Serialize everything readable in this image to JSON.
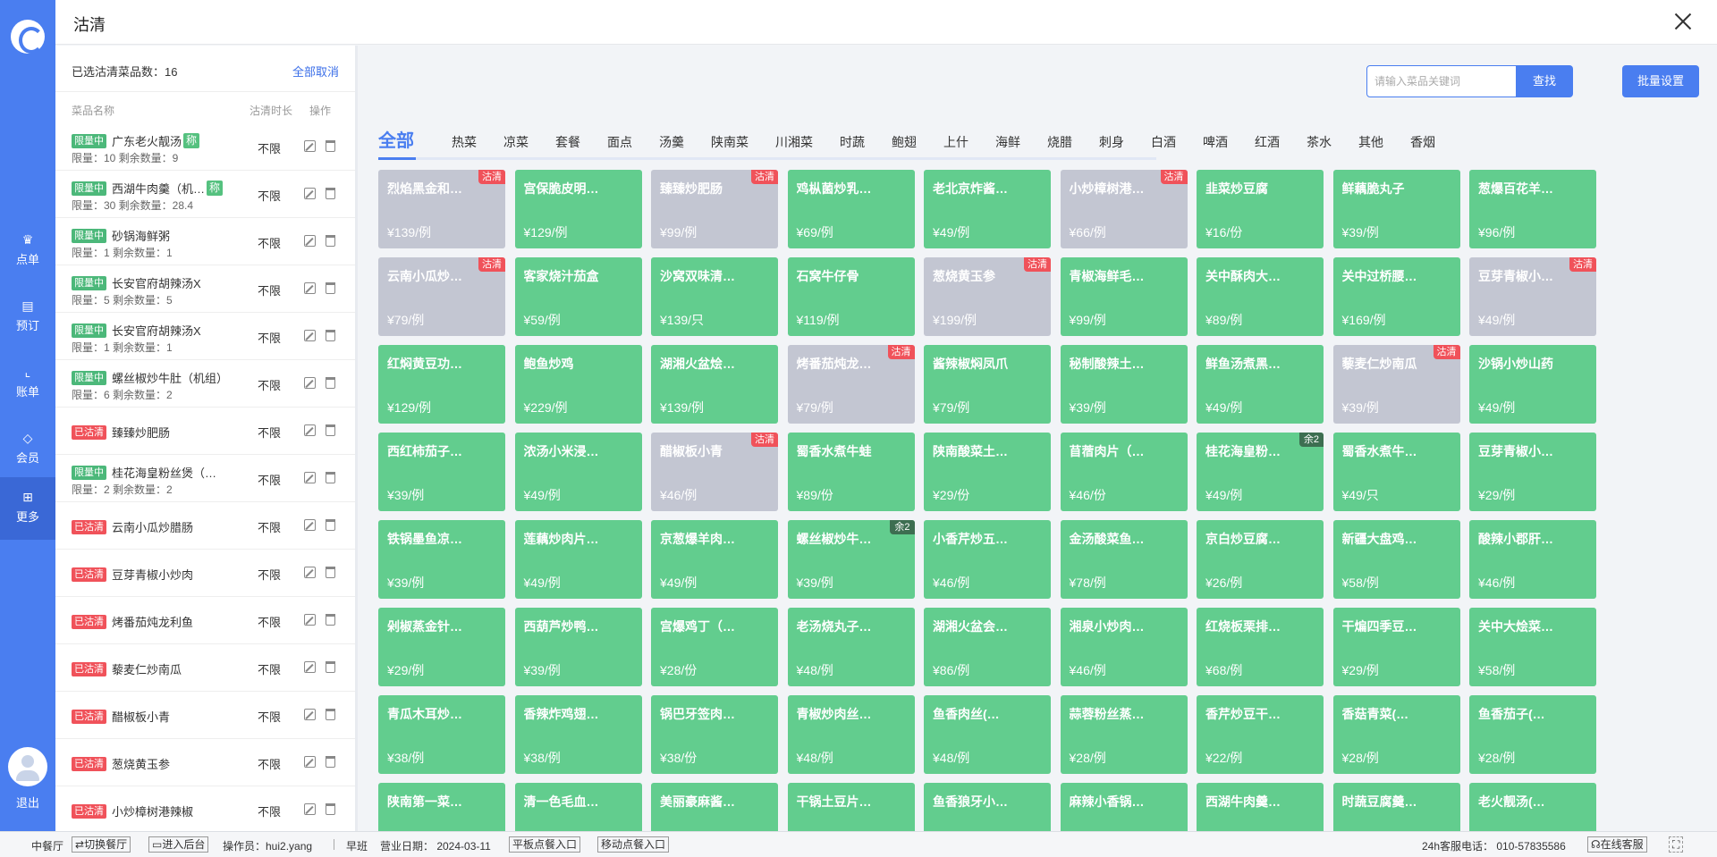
{
  "title": "沽清",
  "nav": [
    {
      "label": "点单",
      "icon": "chef-hat-icon"
    },
    {
      "label": "预订",
      "icon": "book-icon"
    },
    {
      "label": "账单",
      "icon": "chart-icon"
    },
    {
      "label": "会员",
      "icon": "diamond-icon"
    },
    {
      "label": "更多",
      "icon": "grid-icon"
    }
  ],
  "logout": "退出",
  "left": {
    "count_label": "已选沽清菜品数：16",
    "cancel_all": "全部取消",
    "col_name": "菜品名称",
    "col_duration": "沽清时长",
    "col_op": "操作",
    "rows": [
      {
        "tag": "限量中",
        "tagType": "limit",
        "name": "广东老火靓汤",
        "cheng": "称",
        "line2": "限量：10  剩余数量：9",
        "dur": "不限"
      },
      {
        "tag": "限量中",
        "tagType": "limit",
        "name": "西湖牛肉羹（机…",
        "cheng": "称",
        "line2": "限量：30  剩余数量：28.4",
        "dur": "不限"
      },
      {
        "tag": "限量中",
        "tagType": "limit",
        "name": "砂锅海鲜粥",
        "cheng": "",
        "line2": "限量：1  剩余数量：1",
        "dur": "不限"
      },
      {
        "tag": "限量中",
        "tagType": "limit",
        "name": "长安官府胡辣汤X",
        "cheng": "",
        "line2": "限量：5  剩余数量：5",
        "dur": "不限"
      },
      {
        "tag": "限量中",
        "tagType": "limit",
        "name": "长安官府胡辣汤X",
        "cheng": "",
        "line2": "限量：1  剩余数量：1",
        "dur": "不限"
      },
      {
        "tag": "限量中",
        "tagType": "limit",
        "name": "螺丝椒炒牛肚（机组）",
        "cheng": "",
        "line2": "限量：6  剩余数量：2",
        "dur": "不限"
      },
      {
        "tag": "已沽清",
        "tagType": "sold",
        "name": "臻臻炒肥肠",
        "cheng": "",
        "line2": "",
        "dur": "不限"
      },
      {
        "tag": "限量中",
        "tagType": "limit",
        "name": "桂花海皇粉丝煲（…",
        "cheng": "",
        "line2": "限量：2  剩余数量：2",
        "dur": "不限"
      },
      {
        "tag": "已沽清",
        "tagType": "sold",
        "name": "云南小瓜炒腊肠",
        "cheng": "",
        "line2": "",
        "dur": "不限"
      },
      {
        "tag": "已沽清",
        "tagType": "sold",
        "name": "豆芽青椒小炒肉",
        "cheng": "",
        "line2": "",
        "dur": "不限"
      },
      {
        "tag": "已沽清",
        "tagType": "sold",
        "name": "烤番茄炖龙利鱼",
        "cheng": "",
        "line2": "",
        "dur": "不限"
      },
      {
        "tag": "已沽清",
        "tagType": "sold",
        "name": "藜麦仁炒南瓜",
        "cheng": "",
        "line2": "",
        "dur": "不限"
      },
      {
        "tag": "已沽清",
        "tagType": "sold",
        "name": "醋椒板小青",
        "cheng": "",
        "line2": "",
        "dur": "不限"
      },
      {
        "tag": "已沽清",
        "tagType": "sold",
        "name": "葱烧黄玉参",
        "cheng": "",
        "line2": "",
        "dur": "不限"
      },
      {
        "tag": "已沽清",
        "tagType": "sold",
        "name": "小炒樟树港辣椒",
        "cheng": "",
        "line2": "",
        "dur": "不限"
      }
    ]
  },
  "search": {
    "placeholder": "请输入菜品关键词",
    "value": "",
    "find": "查找",
    "batch": "批量设置"
  },
  "tabs": [
    "全部",
    "热菜",
    "凉菜",
    "套餐",
    "面点",
    "汤羹",
    "陕南菜",
    "川湘菜",
    "时蔬",
    "鲍翅",
    "上什",
    "海鲜",
    "烧腊",
    "刺身",
    "白酒",
    "啤酒",
    "红酒",
    "茶水",
    "其他",
    "香烟"
  ],
  "sold_badge": "沽清",
  "dishes": [
    {
      "name": "烈焰黑金和…",
      "price": "¥139/例",
      "status": "sold"
    },
    {
      "name": "宫保脆皮明…",
      "price": "¥129/例",
      "status": ""
    },
    {
      "name": "臻臻炒肥肠",
      "price": "¥99/例",
      "status": "sold"
    },
    {
      "name": "鸡枞菌炒乳…",
      "price": "¥69/例",
      "status": ""
    },
    {
      "name": "老北京炸酱…",
      "price": "¥49/例",
      "status": ""
    },
    {
      "name": "小炒樟树港…",
      "price": "¥66/例",
      "status": "sold"
    },
    {
      "name": "韭菜炒豆腐",
      "price": "¥16/份",
      "status": ""
    },
    {
      "name": "鲜藕脆丸子",
      "price": "¥39/例",
      "status": ""
    },
    {
      "name": "葱爆百花羊…",
      "price": "¥96/例",
      "status": ""
    },
    {
      "name": "云南小瓜炒…",
      "price": "¥79/例",
      "status": "sold"
    },
    {
      "name": "客家烧汁茄盒",
      "price": "¥59/例",
      "status": ""
    },
    {
      "name": "沙窝双味清…",
      "price": "¥139/只",
      "status": ""
    },
    {
      "name": "石窝牛仔骨",
      "price": "¥119/例",
      "status": ""
    },
    {
      "name": "葱烧黄玉参",
      "price": "¥199/例",
      "status": "sold"
    },
    {
      "name": "青椒海鲜毛…",
      "price": "¥99/例",
      "status": ""
    },
    {
      "name": "关中酥肉大…",
      "price": "¥89/例",
      "status": ""
    },
    {
      "name": "关中过桥腰…",
      "price": "¥169/例",
      "status": ""
    },
    {
      "name": "豆芽青椒小…",
      "price": "¥49/例",
      "status": "sold"
    },
    {
      "name": "红焖黄豆功…",
      "price": "¥129/例",
      "status": ""
    },
    {
      "name": "鲍鱼炒鸡",
      "price": "¥229/例",
      "status": ""
    },
    {
      "name": "湖湘火盆烩…",
      "price": "¥139/例",
      "status": ""
    },
    {
      "name": "烤番茄炖龙…",
      "price": "¥79/例",
      "status": "sold"
    },
    {
      "name": "酱辣椒焖凤爪",
      "price": "¥79/例",
      "status": ""
    },
    {
      "name": "秘制酸辣土…",
      "price": "¥39/例",
      "status": ""
    },
    {
      "name": "鲜鱼汤煮黑…",
      "price": "¥49/例",
      "status": ""
    },
    {
      "name": "藜麦仁炒南瓜",
      "price": "¥39/例",
      "status": "sold"
    },
    {
      "name": "沙锅小炒山药",
      "price": "¥49/例",
      "status": ""
    },
    {
      "name": "西红柿茄子…",
      "price": "¥39/例",
      "status": ""
    },
    {
      "name": "浓汤小米浸…",
      "price": "¥49/例",
      "status": ""
    },
    {
      "name": "醋椒板小青",
      "price": "¥46/例",
      "status": "sold"
    },
    {
      "name": "蜀香水煮牛蛙",
      "price": "¥89/份",
      "status": ""
    },
    {
      "name": "陕南酸菜土…",
      "price": "¥29/份",
      "status": ""
    },
    {
      "name": "苜蓿肉片（…",
      "price": "¥46/份",
      "status": ""
    },
    {
      "name": "桂花海皇粉…",
      "price": "¥49/例",
      "status": "left",
      "badge": "余2"
    },
    {
      "name": "蜀香水煮牛…",
      "price": "¥49/只",
      "status": ""
    },
    {
      "name": "豆芽青椒小…",
      "price": "¥29/例",
      "status": ""
    },
    {
      "name": "铁锅墨鱼凉…",
      "price": "¥39/例",
      "status": ""
    },
    {
      "name": "莲藕炒肉片…",
      "price": "¥49/例",
      "status": ""
    },
    {
      "name": "京葱爆羊肉…",
      "price": "¥49/例",
      "status": ""
    },
    {
      "name": "螺丝椒炒牛…",
      "price": "¥39/例",
      "status": "left",
      "badge": "余2"
    },
    {
      "name": "小香芹炒五…",
      "price": "¥46/例",
      "status": ""
    },
    {
      "name": "金汤酸菜鱼…",
      "price": "¥78/例",
      "status": ""
    },
    {
      "name": "京白炒豆腐…",
      "price": "¥26/例",
      "status": ""
    },
    {
      "name": "新疆大盘鸡…",
      "price": "¥58/例",
      "status": ""
    },
    {
      "name": "酸辣小郡肝…",
      "price": "¥46/例",
      "status": ""
    },
    {
      "name": "剁椒蒸金针…",
      "price": "¥29/例",
      "status": ""
    },
    {
      "name": "西葫芦炒鸭…",
      "price": "¥39/例",
      "status": ""
    },
    {
      "name": "宫爆鸡丁（…",
      "price": "¥28/份",
      "status": ""
    },
    {
      "name": "老汤烧丸子…",
      "price": "¥48/例",
      "status": ""
    },
    {
      "name": "湖湘火盆会…",
      "price": "¥86/例",
      "status": ""
    },
    {
      "name": "湘泉小炒肉…",
      "price": "¥46/例",
      "status": ""
    },
    {
      "name": "红烧板栗排…",
      "price": "¥68/例",
      "status": ""
    },
    {
      "name": "干煸四季豆…",
      "price": "¥29/例",
      "status": ""
    },
    {
      "name": "关中大烩菜…",
      "price": "¥58/例",
      "status": ""
    },
    {
      "name": "青瓜木耳炒…",
      "price": "¥38/例",
      "status": ""
    },
    {
      "name": "香辣炸鸡翅…",
      "price": "¥38/例",
      "status": ""
    },
    {
      "name": "锅巴牙签肉…",
      "price": "¥38/份",
      "status": ""
    },
    {
      "name": "青椒炒肉丝…",
      "price": "¥48/例",
      "status": ""
    },
    {
      "name": "鱼香肉丝(…",
      "price": "¥48/例",
      "status": ""
    },
    {
      "name": "蒜蓉粉丝蒸…",
      "price": "¥28/例",
      "status": ""
    },
    {
      "name": "香芹炒豆干…",
      "price": "¥22/例",
      "status": ""
    },
    {
      "name": "香菇青菜(…",
      "price": "¥28/例",
      "status": ""
    },
    {
      "name": "鱼香茄子(…",
      "price": "¥28/例",
      "status": ""
    },
    {
      "name": "陕南第一菜…",
      "price": "",
      "status": ""
    },
    {
      "name": "清一色毛血…",
      "price": "",
      "status": ""
    },
    {
      "name": "美丽豪麻酱…",
      "price": "",
      "status": ""
    },
    {
      "name": "干锅土豆片…",
      "price": "",
      "status": ""
    },
    {
      "name": "鱼香狼牙小…",
      "price": "",
      "status": ""
    },
    {
      "name": "麻辣小香锅…",
      "price": "",
      "status": ""
    },
    {
      "name": "西湖牛肉羹…",
      "price": "",
      "status": ""
    },
    {
      "name": "时蔬豆腐羹…",
      "price": "",
      "status": ""
    },
    {
      "name": "老火靓汤(…",
      "price": "",
      "status": ""
    }
  ],
  "status": {
    "restaurant": "中餐厅",
    "switch": "切换餐厅",
    "backend": "进入后台",
    "operator": "操作员：hui2.yang",
    "shift": "早班",
    "bizdate": "营业日期：  2024-03-11",
    "tablet": "平板点餐入口",
    "mobile": "移动点餐入口",
    "hotline": "24h客服电话：  010-57835586",
    "online": "在线客服"
  }
}
